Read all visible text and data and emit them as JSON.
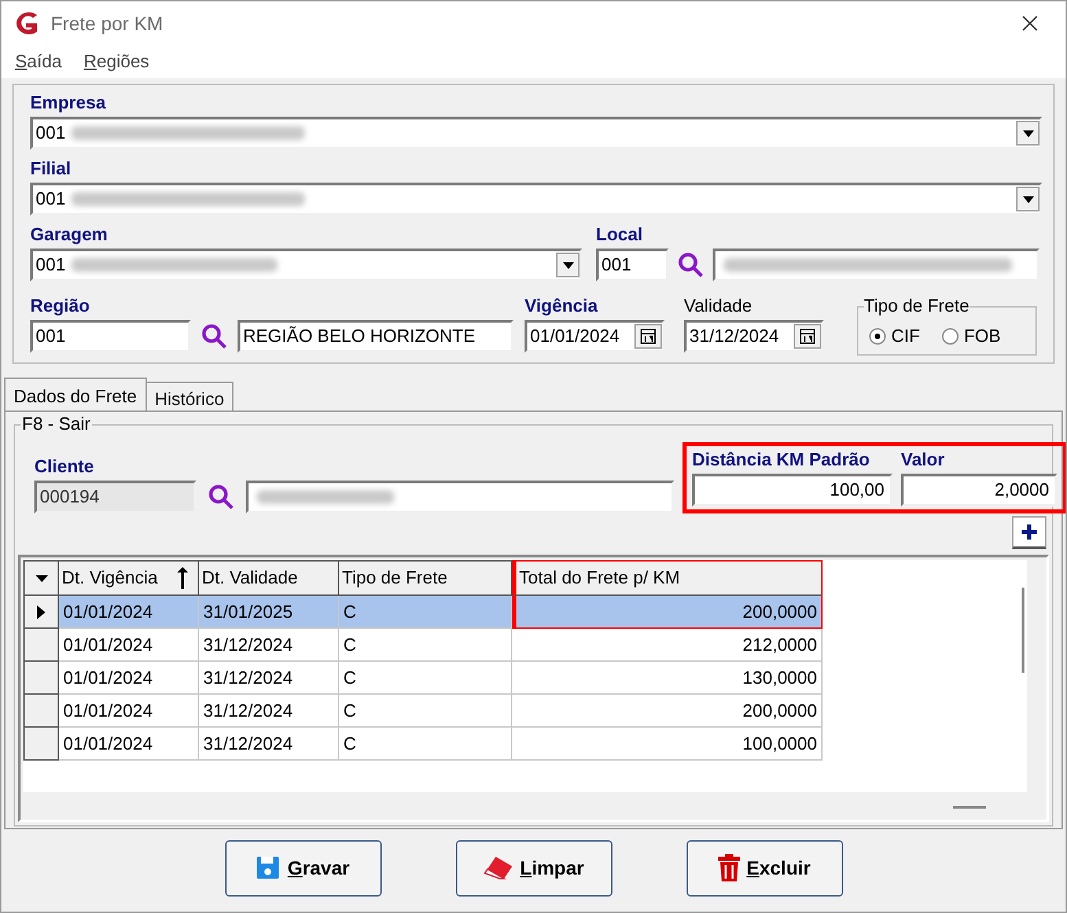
{
  "window": {
    "title": "Frete por KM"
  },
  "menu": [
    {
      "label": "Saída"
    },
    {
      "label": "Regiões"
    }
  ],
  "empresa": {
    "label": "Empresa",
    "required": true,
    "code": "001"
  },
  "filial": {
    "label": "Filial",
    "required": true,
    "code": "001"
  },
  "garagem": {
    "label": "Garagem",
    "required": true,
    "code": "001"
  },
  "local": {
    "label": "Local",
    "required": true,
    "code": "001"
  },
  "regiao": {
    "label": "Região",
    "required": true,
    "code": "001",
    "name": "REGIÃO BELO HORIZONTE"
  },
  "vigencia": {
    "label": "Vigência",
    "required": true,
    "value": "01/01/2024"
  },
  "validade": {
    "label": "Validade",
    "required": false,
    "value": "31/12/2024"
  },
  "tipo_frete": {
    "label": "Tipo de Frete",
    "options": [
      {
        "label": "CIF",
        "selected": true
      },
      {
        "label": "FOB",
        "selected": false
      }
    ]
  },
  "tabs": [
    {
      "label": "Dados do Frete",
      "selected": true
    },
    {
      "label": "Histórico",
      "selected": false
    }
  ],
  "group_title": "F8 - Sair",
  "cliente": {
    "label": "Cliente",
    "required": true,
    "code": "000194",
    "readonly": true
  },
  "km_panel": {
    "highlighted": true,
    "distancia": {
      "label": "Distância KM Padrão",
      "required": true,
      "value": "100,00"
    },
    "valor": {
      "label": "Valor",
      "required": true,
      "value": "2,0000"
    }
  },
  "table": {
    "columns": [
      {
        "label": "Dt. Vigência",
        "sorted": true,
        "highlighted": false
      },
      {
        "label": "Dt. Validade",
        "sorted": false,
        "highlighted": false
      },
      {
        "label": "Tipo de Frete",
        "sorted": false,
        "highlighted": false
      },
      {
        "label": "Total do Frete p/ KM",
        "sorted": false,
        "highlighted": true
      }
    ],
    "rows": [
      {
        "selected": true,
        "highlighted": true,
        "cells": [
          "01/01/2024",
          "31/01/2025",
          "C",
          "200,0000"
        ]
      },
      {
        "selected": false,
        "highlighted": false,
        "cells": [
          "01/01/2024",
          "31/12/2024",
          "C",
          "212,0000"
        ]
      },
      {
        "selected": false,
        "highlighted": false,
        "cells": [
          "01/01/2024",
          "31/12/2024",
          "C",
          "130,0000"
        ]
      },
      {
        "selected": false,
        "highlighted": false,
        "cells": [
          "01/01/2024",
          "31/12/2024",
          "C",
          "200,0000"
        ]
      },
      {
        "selected": false,
        "highlighted": false,
        "cells": [
          "01/01/2024",
          "31/12/2024",
          "C",
          "100,0000"
        ]
      }
    ]
  },
  "buttons": [
    {
      "kind": "save",
      "label": "Gravar"
    },
    {
      "kind": "clear",
      "label": "Limpar"
    },
    {
      "kind": "delete",
      "label": "Excluir"
    }
  ]
}
